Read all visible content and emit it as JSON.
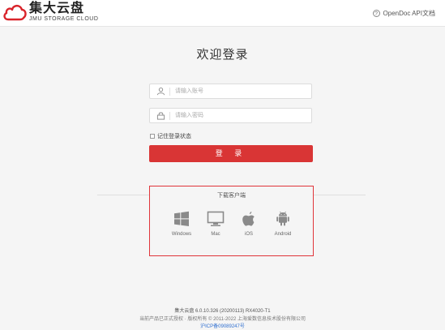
{
  "header": {
    "logo_cn": "集大云盘",
    "logo_en": "JMU STORAGE CLOUD",
    "help_link": "OpenDoc API文档"
  },
  "login": {
    "title": "欢迎登录",
    "username_placeholder": "请输入账号",
    "password_placeholder": "请输入密码",
    "remember_label": "记住登录状态",
    "login_button": "登 录"
  },
  "download": {
    "title": "下载客户端",
    "platforms": [
      {
        "label": "Windows",
        "icon": "windows-icon"
      },
      {
        "label": "Mac",
        "icon": "mac-monitor-icon"
      },
      {
        "label": "iOS",
        "icon": "apple-icon"
      },
      {
        "label": "Android",
        "icon": "android-icon"
      }
    ]
  },
  "footer": {
    "version": "集大云盘 6.0.10.326 (20200113)   RX4020-T1",
    "copyright": "当前产品已正式授权 · 版权所有 © 2011-2022 上海爱数信息技术股份有限公司",
    "icp": "沪ICP备09089247号"
  },
  "colors": {
    "accent": "#d93535",
    "highlight_border": "#e0353a",
    "link": "#2f6fd0",
    "logo_red": "#d9242b"
  }
}
